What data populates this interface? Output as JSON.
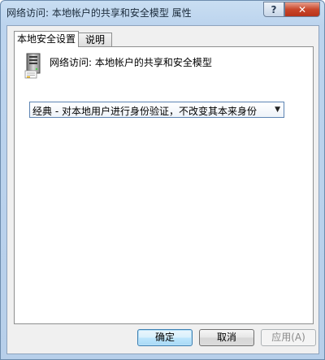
{
  "window": {
    "title": "网络访问: 本地帐户的共享和安全模型 属性",
    "help_label": "?",
    "close_label": "✕"
  },
  "tabs": [
    {
      "label": "本地安全设置",
      "active": true
    },
    {
      "label": "说明",
      "active": false
    }
  ],
  "policy": {
    "name": "网络访问: 本地帐户的共享和安全模型",
    "icon": "server-icon"
  },
  "setting": {
    "selected": "经典 - 对本地用户进行身份验证，不改变其本来身份"
  },
  "buttons": {
    "ok": "确定",
    "cancel": "取消",
    "apply": "应用(A)"
  },
  "colors": {
    "title_gradient_top": "#c9def2",
    "close_button": "#c9472b",
    "default_button_border": "#3c7fb1"
  }
}
